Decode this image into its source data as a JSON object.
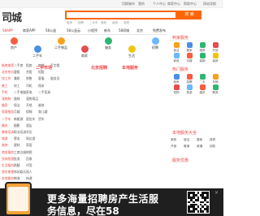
{
  "topbar": {
    "links": [
      "切换城市",
      "我的",
      "个人中心",
      "商家中心",
      "帮助中心",
      "网站导航"
    ]
  },
  "logo": {
    "text": "司城"
  },
  "search": {
    "button_label": "搜 索",
    "placeholder": ""
  },
  "hot_words": [
    "租房",
    "招聘",
    "二手车",
    "家政",
    "装修",
    "宠物"
  ],
  "nav": {
    "items": [
      {
        "label": "58APP",
        "red": true
      },
      {
        "label": "商家APP",
        "red": false
      },
      {
        "label": "58公益",
        "red": false
      },
      {
        "label": "58公益云",
        "red": false
      },
      {
        "label": "小程序",
        "red": false
      },
      {
        "label": "新车",
        "red": false
      },
      {
        "label": "58同城",
        "red": false
      },
      {
        "label": "北京",
        "red": false
      },
      {
        "label": "免费发布",
        "red": false
      }
    ]
  },
  "categories": [
    {
      "label": "房产",
      "color": "#f75c3d"
    },
    {
      "label": "二手车",
      "color": "#4a90e2"
    },
    {
      "label": "二手物品",
      "color": "#f7a21b"
    },
    {
      "label": "商家",
      "color": "#e34d4d"
    },
    {
      "label": "服务",
      "color": "#2fb573"
    },
    {
      "label": "生活",
      "color": "#f1c40f"
    },
    {
      "label": "招聘",
      "color": "#6ab7ff"
    }
  ],
  "rows": [
    [
      "新房推荐",
      "二手房",
      "租房",
      "商铺",
      "写字楼",
      "",
      "",
      "",
      ""
    ],
    [
      "北京房价",
      "整租",
      "合租",
      "短租",
      "",
      "",
      "",
      "",
      ""
    ],
    [
      "找工作",
      "兼职",
      "销售",
      "客服",
      "服务员",
      "",
      "",
      "",
      ""
    ],
    [
      "普工",
      "技工",
      "司机",
      "保安",
      "",
      "",
      "",
      "",
      ""
    ],
    [
      "手机",
      "二手电脑",
      "家电",
      "二手家具",
      "",
      "",
      "",
      "",
      ""
    ],
    [
      "宠物狗",
      "猫咪",
      "宠物用品",
      "",
      "",
      "",
      "",
      "",
      ""
    ],
    [
      "搬家",
      "保洁",
      "开锁",
      "维修",
      "",
      "",
      "",
      "",
      ""
    ],
    [
      "家政服务",
      "月嫂",
      "保姆",
      "育儿嫂",
      "",
      "",
      "",
      "",
      ""
    ],
    [
      "二手车",
      "新能源",
      "面包车",
      "货车",
      "",
      "",
      "",
      "",
      ""
    ],
    [
      "婚庆",
      "摄影",
      "酒店",
      "",
      "",
      "",
      "",
      "",
      ""
    ],
    [
      "教育培训",
      "职业培训",
      "学历",
      "",
      "",
      "",
      "",
      "",
      ""
    ],
    [
      "旅游",
      "票务",
      "周边游",
      "",
      "",
      "",
      "",
      "",
      ""
    ],
    [
      "装修",
      "建材",
      "家居",
      "",
      "",
      "",
      "",
      "",
      ""
    ],
    [
      "商务服务",
      "工商注册",
      "财税",
      "",
      "",
      "",
      "",
      "",
      ""
    ],
    [
      "农林牧渔",
      "批发",
      "回收",
      "",
      "",
      "",
      "",
      "",
      ""
    ],
    [
      "生活服务",
      "跑腿",
      "代驾",
      "",
      "",
      "",
      "",
      "",
      ""
    ],
    [
      "餐饮美食",
      "休闲娱乐",
      "丽人",
      "",
      "",
      "",
      "",
      "",
      ""
    ],
    [
      "本地服务",
      "物流",
      "快递",
      "",
      "",
      "",
      "",
      "",
      ""
    ]
  ],
  "column_heads": [
    "二手市场",
    "北京招聘",
    "本地服务"
  ],
  "right_panel": {
    "title1": "到家服务",
    "grid1": [
      {
        "label": "保洁",
        "color": "#f7a21b"
      },
      {
        "label": "搬家",
        "color": "#4a90e2"
      },
      {
        "label": "维修",
        "color": "#2fb573"
      },
      {
        "label": "开锁",
        "color": "#e34d4d"
      },
      {
        "label": "家政",
        "color": "#6ab7ff"
      },
      {
        "label": "月嫂",
        "color": "#f75c3d"
      },
      {
        "label": "保姆",
        "color": "#2fb573"
      },
      {
        "label": "装修",
        "color": "#f1c40f"
      }
    ],
    "title2": "热门服务",
    "grid2": [
      {
        "label": "租房",
        "color": "#4a90e2"
      },
      {
        "label": "招聘",
        "color": "#f75c3d"
      },
      {
        "label": "二手",
        "color": "#2fb573"
      },
      {
        "label": "车辆",
        "color": "#f7a21b"
      },
      {
        "label": "宠物",
        "color": "#e34d4d"
      },
      {
        "label": "旅游",
        "color": "#6ab7ff"
      },
      {
        "label": "婚庆",
        "color": "#f75c3d"
      },
      {
        "label": "教育",
        "color": "#2fb573"
      }
    ],
    "title3": "本地服务大全",
    "list": [
      "家政",
      "保洁",
      "搬家",
      "维修",
      "开锁",
      "管道",
      "疏通",
      "回收"
    ],
    "title4": "服务优惠"
  },
  "banner": {
    "line1": "更多海量招聘房产生活服",
    "line2": "务信息，尽在58",
    "close": "×"
  }
}
